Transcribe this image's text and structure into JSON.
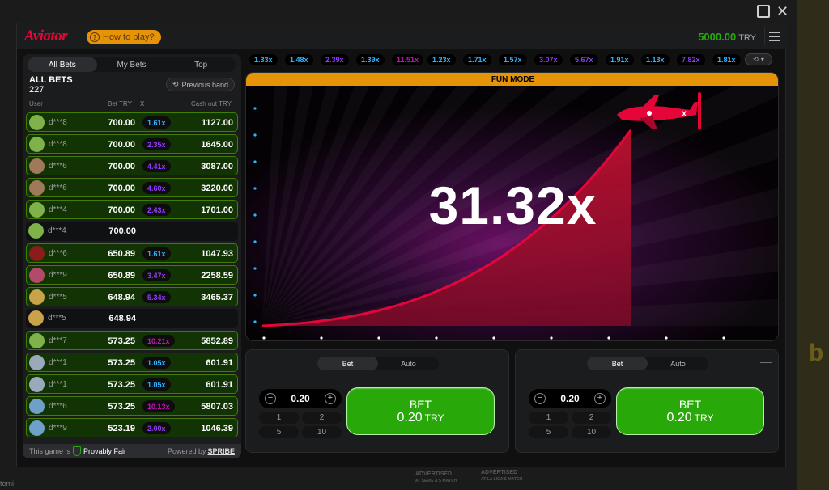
{
  "app": {
    "logo": "Aviator",
    "how_to_play": "How to play?",
    "balance": "5000.00",
    "currency": "TRY"
  },
  "bets_panel": {
    "tabs": [
      "All Bets",
      "My Bets",
      "Top"
    ],
    "title": "ALL BETS",
    "count": "227",
    "previous_hand": "Previous hand",
    "columns": {
      "user": "User",
      "bet": "Bet TRY",
      "x": "X",
      "cashout": "Cash out TRY"
    },
    "rows": [
      {
        "user": "d***8",
        "bet": "700.00",
        "mult": "1.61x",
        "cashout": "1127.00",
        "win": true,
        "avatar": "#7fb24a",
        "mcolor": "#34b4ff"
      },
      {
        "user": "d***8",
        "bet": "700.00",
        "mult": "2.35x",
        "cashout": "1645.00",
        "win": true,
        "avatar": "#7fb24a",
        "mcolor": "#913ef8"
      },
      {
        "user": "d***6",
        "bet": "700.00",
        "mult": "4.41x",
        "cashout": "3087.00",
        "win": true,
        "avatar": "#a0785a",
        "mcolor": "#913ef8"
      },
      {
        "user": "d***6",
        "bet": "700.00",
        "mult": "4.60x",
        "cashout": "3220.00",
        "win": true,
        "avatar": "#a0785a",
        "mcolor": "#913ef8"
      },
      {
        "user": "d***4",
        "bet": "700.00",
        "mult": "2.43x",
        "cashout": "1701.00",
        "win": true,
        "avatar": "#7fb24a",
        "mcolor": "#913ef8"
      },
      {
        "user": "d***4",
        "bet": "700.00",
        "mult": "",
        "cashout": "",
        "win": false,
        "avatar": "#7fb24a",
        "mcolor": "#913ef8"
      },
      {
        "user": "d***6",
        "bet": "650.89",
        "mult": "1.61x",
        "cashout": "1047.93",
        "win": true,
        "avatar": "#8a1c1c",
        "mcolor": "#34b4ff"
      },
      {
        "user": "d***9",
        "bet": "650.89",
        "mult": "3.47x",
        "cashout": "2258.59",
        "win": true,
        "avatar": "#b44a6a",
        "mcolor": "#913ef8"
      },
      {
        "user": "d***5",
        "bet": "648.94",
        "mult": "5.34x",
        "cashout": "3465.37",
        "win": true,
        "avatar": "#c9a24a",
        "mcolor": "#913ef8"
      },
      {
        "user": "d***5",
        "bet": "648.94",
        "mult": "",
        "cashout": "",
        "win": false,
        "avatar": "#c9a24a",
        "mcolor": "#913ef8"
      },
      {
        "user": "d***7",
        "bet": "573.25",
        "mult": "10.21x",
        "cashout": "5852.89",
        "win": true,
        "avatar": "#7fb24a",
        "mcolor": "#c017b4"
      },
      {
        "user": "d***1",
        "bet": "573.25",
        "mult": "1.05x",
        "cashout": "601.91",
        "win": true,
        "avatar": "#9aaabb",
        "mcolor": "#34b4ff"
      },
      {
        "user": "d***1",
        "bet": "573.25",
        "mult": "1.05x",
        "cashout": "601.91",
        "win": true,
        "avatar": "#9aaabb",
        "mcolor": "#34b4ff"
      },
      {
        "user": "d***6",
        "bet": "573.25",
        "mult": "10.13x",
        "cashout": "5807.03",
        "win": true,
        "avatar": "#6fa0c8",
        "mcolor": "#c017b4"
      },
      {
        "user": "d***9",
        "bet": "523.19",
        "mult": "2.00x",
        "cashout": "1046.39",
        "win": true,
        "avatar": "#6fa0c8",
        "mcolor": "#913ef8"
      }
    ],
    "footer_game": "This game is",
    "footer_fair": "Provably Fair",
    "footer_powered": "Powered by",
    "footer_brand": "SPRIBE"
  },
  "history": [
    {
      "v": "1.33x",
      "c": "#34b4ff"
    },
    {
      "v": "1.48x",
      "c": "#34b4ff"
    },
    {
      "v": "2.39x",
      "c": "#913ef8"
    },
    {
      "v": "1.39x",
      "c": "#34b4ff"
    },
    {
      "v": "11.51x",
      "c": "#c017b4"
    },
    {
      "v": "1.23x",
      "c": "#34b4ff"
    },
    {
      "v": "1.71x",
      "c": "#34b4ff"
    },
    {
      "v": "1.57x",
      "c": "#34b4ff"
    },
    {
      "v": "3.07x",
      "c": "#913ef8"
    },
    {
      "v": "5.67x",
      "c": "#913ef8"
    },
    {
      "v": "1.91x",
      "c": "#34b4ff"
    },
    {
      "v": "1.13x",
      "c": "#34b4ff"
    },
    {
      "v": "7.82x",
      "c": "#913ef8"
    },
    {
      "v": "1.81x",
      "c": "#34b4ff"
    }
  ],
  "game": {
    "banner": "FUN MODE",
    "multiplier": "31.32x"
  },
  "bet_panels": [
    {
      "tabs": [
        "Bet",
        "Auto"
      ],
      "amount": "0.20",
      "quick": [
        "1",
        "2",
        "5",
        "10"
      ],
      "button_label": "BET",
      "button_amount": "0.20",
      "button_currency": "TRY"
    },
    {
      "tabs": [
        "Bet",
        "Auto"
      ],
      "amount": "0.20",
      "quick": [
        "1",
        "2",
        "5",
        "10"
      ],
      "button_label": "BET",
      "button_amount": "0.20",
      "button_currency": "TRY",
      "minus": "—"
    }
  ],
  "ads": {
    "ad1_l1": "ADVERTISED",
    "ad1_l2": "AT SERIE A'S MATCH",
    "ad2_l1": "ADVERTISED",
    "ad2_l2": "AT LA LIGA'S MATCH"
  },
  "bottom_text": "temi"
}
